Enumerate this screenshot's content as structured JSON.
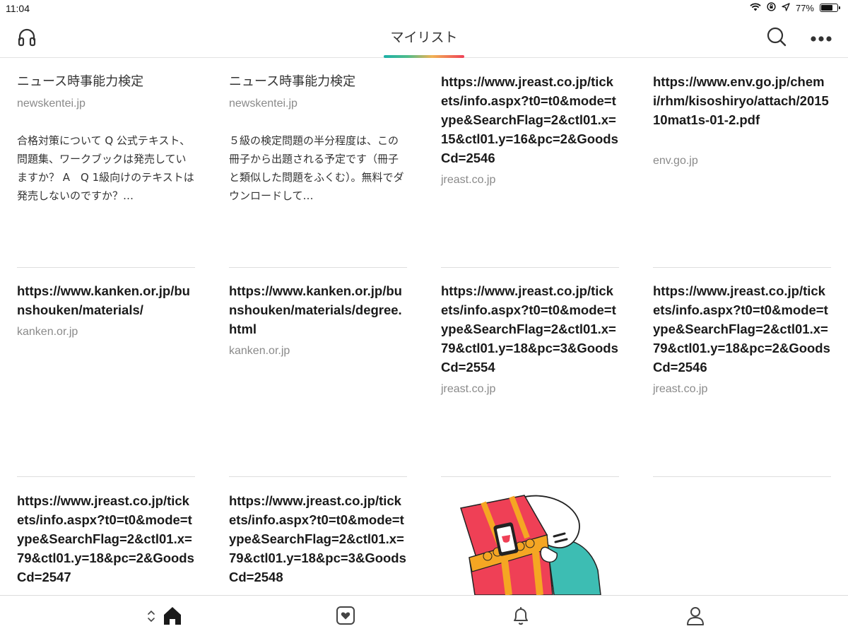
{
  "status_bar": {
    "time": "11:04",
    "battery_text": "77%",
    "battery_level": 0.77,
    "icons": [
      "wifi-icon",
      "screen-lock-icon",
      "location-arrow-icon",
      "battery-icon"
    ]
  },
  "nav": {
    "title": "マイリスト",
    "left_icon": "headphones-icon",
    "right_icons": [
      "search-icon",
      "more-icon"
    ],
    "accent_colors": [
      "#1cb0a8",
      "#50bc8a",
      "#f0b254",
      "#ef4056"
    ]
  },
  "cards": [
    {
      "title": "ニュース時事能力検定",
      "domain": "newskentei.jp",
      "excerpt": "合格対策について Q 公式テキスト、問題集、ワークブックは発売していますか？ A　Q 1級向けのテキストは発売しないのですか？…"
    },
    {
      "title": "ニュース時事能力検定",
      "domain": "newskentei.jp",
      "excerpt": "５級の検定問題の半分程度は、この冊子から出題される予定です（冊子と類似した問題をふくむ）。無料でダウンロードして…"
    },
    {
      "title": "https://www.jreast.co.jp/tickets/info.aspx?t0=t0&mode=type&SearchFlag=2&ctl01.x=15&ctl01.y=16&pc=2&GoodsCd=2546",
      "domain": "jreast.co.jp"
    },
    {
      "title": "https://www.env.go.jp/chemi/rhm/kisoshiryo/attach/201510mat1s-01-2.pdf",
      "domain": "env.go.jp"
    },
    {
      "title": "https://www.kanken.or.jp/bunshouken/materials/",
      "domain": "kanken.or.jp"
    },
    {
      "title": "https://www.kanken.or.jp/bunshouken/materials/degree.html",
      "domain": "kanken.or.jp"
    },
    {
      "title": "https://www.jreast.co.jp/tickets/info.aspx?t0=t0&mode=type&SearchFlag=2&ctl01.x=79&ctl01.y=18&pc=3&GoodsCd=2554",
      "domain": "jreast.co.jp"
    },
    {
      "title": "https://www.jreast.co.jp/tickets/info.aspx?t0=t0&mode=type&SearchFlag=2&ctl01.x=79&ctl01.y=18&pc=2&GoodsCd=2546",
      "domain": "jreast.co.jp"
    },
    {
      "title": "https://www.jreast.co.jp/tickets/info.aspx?t0=t0&mode=type&SearchFlag=2&ctl01.x=79&ctl01.y=18&pc=2&GoodsCd=2547"
    },
    {
      "title": "https://www.jreast.co.jp/tickets/info.aspx?t0=t0&mode=type&SearchFlag=2&ctl01.x=79&ctl01.y=18&pc=3&GoodsCd=2548"
    }
  ],
  "tab_bar": {
    "tabs": [
      "home-icon",
      "saves-icon",
      "notifications-icon",
      "profile-icon"
    ],
    "active": "home-icon"
  }
}
